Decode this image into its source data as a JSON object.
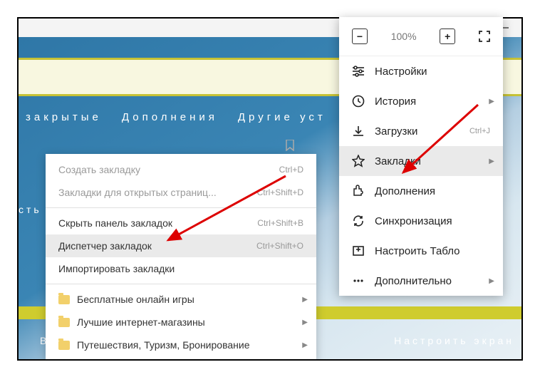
{
  "zoom": {
    "minus": "−",
    "level": "100%",
    "plus": "+"
  },
  "nav_tabs": {
    "closed": "закрытые",
    "addons": "Дополнения",
    "other_devices": "Другие уст"
  },
  "left_clip": "сть",
  "bottom": {
    "left_fragment": "В о",
    "customize_screen": "Настроить экран"
  },
  "main_menu": {
    "settings": "Настройки",
    "history": "История",
    "downloads": "Загрузки",
    "downloads_shortcut": "Ctrl+J",
    "bookmarks": "Закладки",
    "addons": "Дополнения",
    "sync": "Синхронизация",
    "panel": "Настроить Табло",
    "more": "Дополнительно"
  },
  "submenu": {
    "create": "Создать закладку",
    "create_short": "Ctrl+D",
    "open_pages": "Закладки для открытых страниц...",
    "open_pages_short": "Ctrl+Shift+D",
    "hide_bar": "Скрыть панель закладок",
    "hide_bar_short": "Ctrl+Shift+B",
    "manager": "Диспетчер закладок",
    "manager_short": "Ctrl+Shift+O",
    "import": "Импортировать закладки",
    "folders": {
      "f1": "Бесплатные онлайн игры",
      "f2": "Лучшие интернет-магазины",
      "f3": "Путешествия, Туризм, Бронирование"
    }
  }
}
